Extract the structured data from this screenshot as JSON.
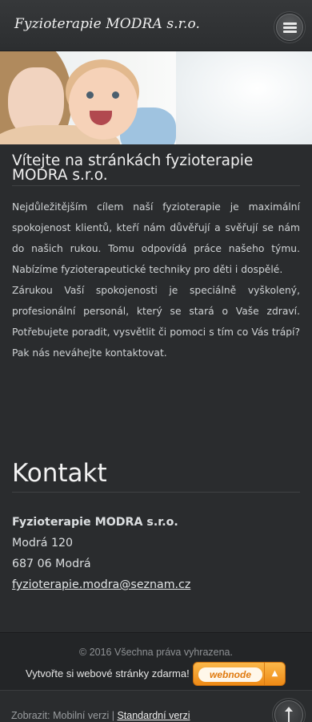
{
  "header": {
    "site_title": "Fyzioterapie MODRA s.r.o."
  },
  "main": {
    "welcome_title": "Vítejte na stránkách fyzioterapie MODRA s.r.o.",
    "paragraphs": [
      "Nejdůležitějším cílem naší fyzioterapie je maximální spokojenost klientů, kteří nám důvěřují a svěřují se nám do našich rukou. Tomu odpovídá práce našeho týmu. Nabízíme fyzioterapeutické techniky pro děti i dospělé.",
      "Zárukou Vaší spokojenosti je speciálně vyškolený, profesionální personál, který se stará o Vaše zdraví. Potřebujete poradit, vysvětlit či pomoci s tím co Vás trápí? Pak nás neváhejte kontaktovat."
    ]
  },
  "contact": {
    "heading": "Kontakt",
    "company": "Fyzioterapie MODRA s.r.o.",
    "street": "Modrá 120",
    "city": "687 06 Modrá",
    "email": "fyzioterapie.modra@seznam.cz"
  },
  "footer": {
    "copyright": "© 2016 Všechna práva vyhrazena.",
    "promo_text": "Vytvořte si webové stránky zdarma!",
    "webnode_label": "webnode",
    "webnode_arrow": "▲"
  },
  "bottom_bar": {
    "view_prefix": "Zobrazit: Mobilní verzi | ",
    "standard_link": "Standardní verzi"
  },
  "colors": {
    "background": "#2a2c2e",
    "accent_orange": "#ee8a16"
  },
  "icons": {
    "menu": "hamburger-menu-icon",
    "back_to_top": "arrow-up-icon"
  }
}
